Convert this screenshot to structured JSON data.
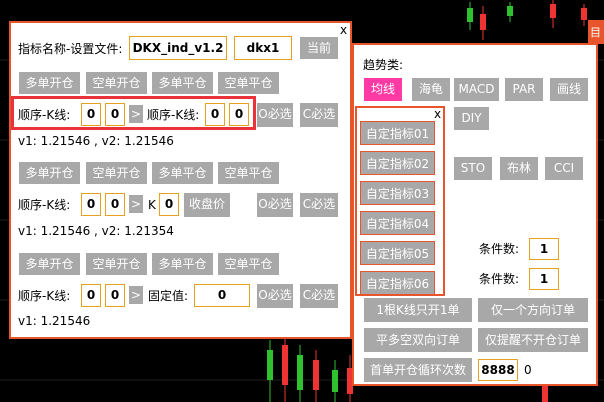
{
  "colors": {
    "accent": "#e8542b",
    "button_bg": "#a8a8a8",
    "input_border": "#e8a020",
    "trend_selected": "#ff3aa5",
    "highlight_frame": "#e8333b"
  },
  "main_panel": {
    "close": "x",
    "indicator_label": "指标名称-设置文件:",
    "indicator_name": "DKX_ind_v1.2",
    "settings_file": "dkx1",
    "current_button": "当前",
    "section1": {
      "buttons": [
        "多单开仓",
        "空单开仓",
        "多单平仓",
        "空单平仓"
      ],
      "seq_label_a": "顺序-K线:",
      "seq_a_1": "0",
      "seq_a_2": "0",
      "compare": ">",
      "seq_label_b": "顺序-K线:",
      "seq_b_1": "0",
      "seq_b_2": "0",
      "o_optional": "O必选",
      "c_required": "C必选",
      "values": "v1: 1.21546 , v2: 1.21546"
    },
    "section2": {
      "buttons": [
        "多单开仓",
        "空单开仓",
        "多单平仓",
        "空单平仓"
      ],
      "seq_label": "顺序-K线:",
      "seq_1": "0",
      "seq_2": "0",
      "compare": ">",
      "k_label": "K",
      "k_value": "0",
      "close_price": "收盘价",
      "o_optional": "O必选",
      "c_required": "C必选",
      "values": "v1: 1.21546 , v2: 1.21354"
    },
    "section3": {
      "buttons": [
        "多单开仓",
        "空单开仓",
        "多单平仓",
        "空单平仓"
      ],
      "seq_label": "顺序-K线:",
      "seq_1": "0",
      "seq_2": "0",
      "compare": ">",
      "fixed_label": "固定值:",
      "fixed_value": "0",
      "o_optional": "O必选",
      "c_required": "C必选",
      "values": "v1: 1.21546"
    }
  },
  "trend_panel": {
    "title": "趋势类:",
    "row1": [
      "均线",
      "海龟",
      "MACD",
      "PAR",
      "画线"
    ],
    "diy": "DIY",
    "row2": [
      "STO",
      "布林",
      "CCI"
    ],
    "condition_label": "条件数:",
    "condition_1": "1",
    "condition_2": "1",
    "btn_new_bar": "1根K线只开1单",
    "btn_one_dir": "仅一个方向订单",
    "btn_flat_reverse": "平多空双向订单",
    "btn_alert_only": "仅提醒不开仓订单",
    "btn_first_loop": "首单开仓循环次数",
    "loop_count": "8888",
    "loop_value": "0"
  },
  "custom_panel": {
    "close": "x",
    "items": [
      "自定指标01",
      "自定指标02",
      "自定指标03",
      "自定指标04",
      "自定指标05",
      "自定指标06"
    ]
  },
  "right_edge_glyph": "目"
}
